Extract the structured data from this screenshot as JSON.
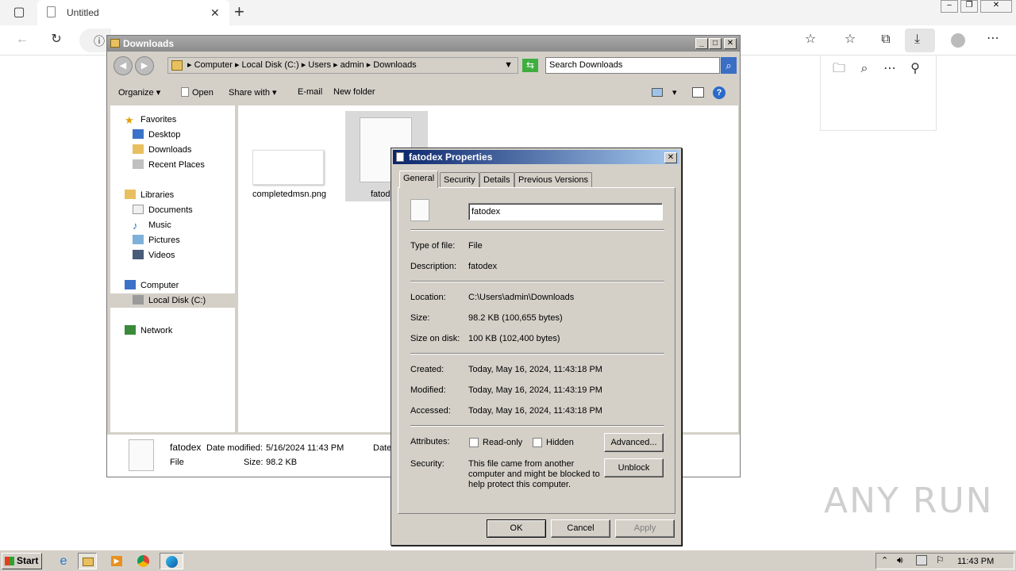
{
  "browser": {
    "tab_title": "Untitled",
    "new_tab_glyph": "+"
  },
  "explorer": {
    "title": "Downloads",
    "breadcrumb": [
      "Computer",
      "Local Disk (C:)",
      "Users",
      "admin",
      "Downloads"
    ],
    "search_placeholder": "Search Downloads",
    "toolbar": {
      "organize": "Organize",
      "open": "Open",
      "share_with": "Share with",
      "email": "E-mail",
      "new_folder": "New folder"
    },
    "nav": {
      "favorites": "Favorites",
      "desktop": "Desktop",
      "downloads": "Downloads",
      "recent_places": "Recent Places",
      "libraries": "Libraries",
      "documents": "Documents",
      "music": "Music",
      "pictures": "Pictures",
      "videos": "Videos",
      "computer": "Computer",
      "local_disk": "Local Disk (C:)",
      "network": "Network"
    },
    "files": [
      {
        "name": "completedmsn.png"
      },
      {
        "name": "fatod"
      }
    ],
    "details": {
      "name": "fatodex",
      "type": "File",
      "modified_label": "Date modified:",
      "modified_value": "5/16/2024 11:43 PM",
      "size_label": "Size:",
      "size_value": "98.2 KB",
      "extra": "Date"
    }
  },
  "properties": {
    "title": "fatodex Properties",
    "tabs": [
      "General",
      "Security",
      "Details",
      "Previous Versions"
    ],
    "filename": "fatodex",
    "type_label": "Type of file:",
    "type_value": "File",
    "desc_label": "Description:",
    "desc_value": "fatodex",
    "location_label": "Location:",
    "location_value": "C:\\Users\\admin\\Downloads",
    "size_label": "Size:",
    "size_value": "98.2 KB (100,655 bytes)",
    "size_disk_label": "Size on disk:",
    "size_disk_value": "100 KB (102,400 bytes)",
    "created_label": "Created:",
    "created_value": "Today, May 16, 2024, 11:43:18 PM",
    "modified_label": "Modified:",
    "modified_value": "Today, May 16, 2024, 11:43:19 PM",
    "accessed_label": "Accessed:",
    "accessed_value": "Today, May 16, 2024, 11:43:18 PM",
    "attributes_label": "Attributes:",
    "readonly": "Read-only",
    "hidden": "Hidden",
    "advanced": "Advanced...",
    "security_label": "Security:",
    "security_line1": "This file came from another",
    "security_line2": "computer and might be blocked to",
    "security_line3": "help protect this computer.",
    "unblock": "Unblock",
    "ok": "OK",
    "cancel": "Cancel",
    "apply": "Apply"
  },
  "taskbar": {
    "start": "Start",
    "clock": "11:43 PM"
  },
  "watermark": "ANY RUN"
}
